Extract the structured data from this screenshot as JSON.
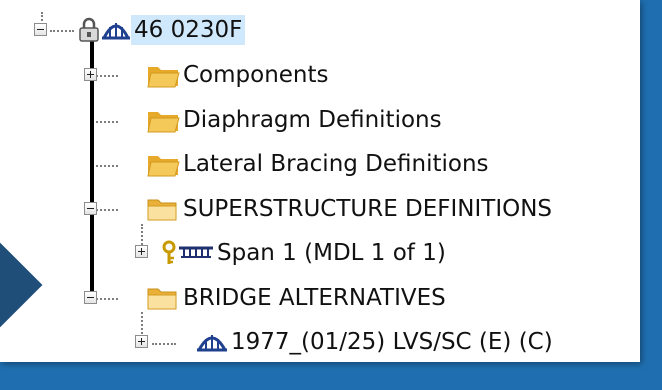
{
  "tree": {
    "root": {
      "label": "46 0230F",
      "icons": [
        "lock-icon",
        "bridge-icon"
      ]
    },
    "items": [
      {
        "label": "Components",
        "icon": "folder-icon"
      },
      {
        "label": "Diaphragm Definitions",
        "icon": "folder-icon"
      },
      {
        "label": "Lateral Bracing Definitions",
        "icon": "folder-icon"
      },
      {
        "label": "SUPERSTRUCTURE DEFINITIONS",
        "icon": "folder-open-icon"
      },
      {
        "label": "Span 1 (MDL 1 of 1)",
        "icons": [
          "key-icon",
          "girder-icon"
        ]
      },
      {
        "label": "BRIDGE ALTERNATIVES",
        "icon": "folder-open-icon"
      },
      {
        "label": "1977_(01/25) LVS/SC (E)  (C)",
        "icon": "bridge-icon"
      }
    ]
  },
  "colors": {
    "selection": "#cfe8fb",
    "folder": "#f2c14e",
    "bridge_icon": "#1f3f8f",
    "background_strip": "#1f6fb0"
  }
}
